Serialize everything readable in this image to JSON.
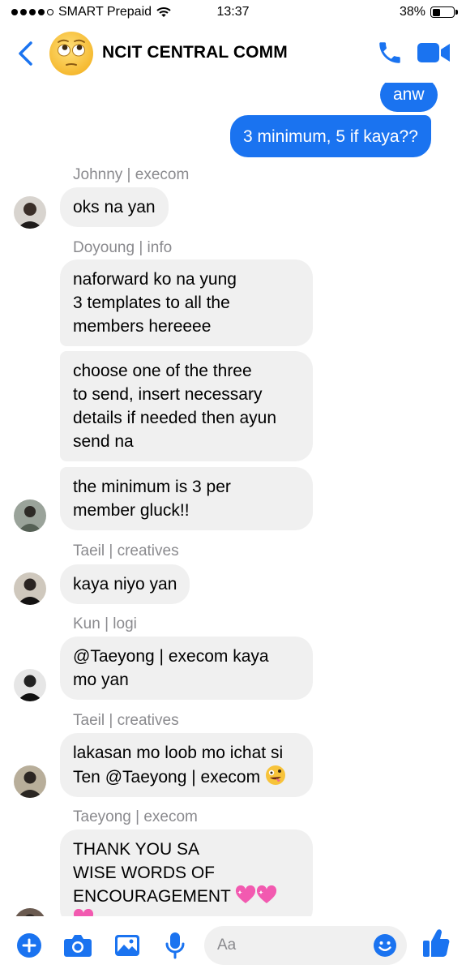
{
  "status_bar": {
    "carrier": "SMART Prepaid",
    "time": "13:37",
    "battery": "38%",
    "battery_level": 0.38
  },
  "header": {
    "title": "NCIT CENTRAL COMM",
    "avatar_icon": "face-with-rolling-eyes-emoji",
    "accent": "#1a73f0"
  },
  "messages": {
    "m1": "anw",
    "m2": "3 minimum, 5 if kaya??",
    "s1": "Johnny | execom",
    "m3": "oks na yan",
    "s2": "Doyoung | info",
    "m4": "naforward ko na yung\n3 templates to all the\nmembers hereeee",
    "m5": "choose one of the three\nto send, insert necessary\ndetails if needed then ayun\nsend na",
    "m6": "the minimum is 3 per\nmember gluck!!",
    "s3": "Taeil | creatives",
    "m7": "kaya niyo yan",
    "s4": "Kun | logi",
    "m8": "@Taeyong | execom kaya\nmo yan",
    "s5": "Taeil | creatives",
    "m9_line1": "lakasan mo loob mo ichat si",
    "m9_line2": "Ten @Taeyong | execom",
    "s6": "Taeyong | execom",
    "m10_line1": "THANK YOU SA",
    "m10_line2": "WISE WORDS OF",
    "m10_line3": "ENCOURAGEMENT"
  },
  "composer": {
    "placeholder": "Aa"
  }
}
